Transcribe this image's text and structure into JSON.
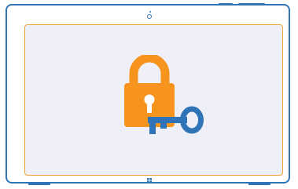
{
  "device": {
    "type": "tablet",
    "frame_color": "#2f74b7",
    "screen_color": "#efeff8",
    "screen_border_color": "#f0a23b"
  },
  "screen": {
    "illustration": {
      "lock_icon": "padlock-icon",
      "key_icon": "key-icon",
      "lock_color": "#f7941d",
      "key_color": "#2f74b7"
    }
  },
  "hardware": {
    "camera_icon": "camera-icon",
    "home_button_icon": "windows-logo-icon"
  }
}
